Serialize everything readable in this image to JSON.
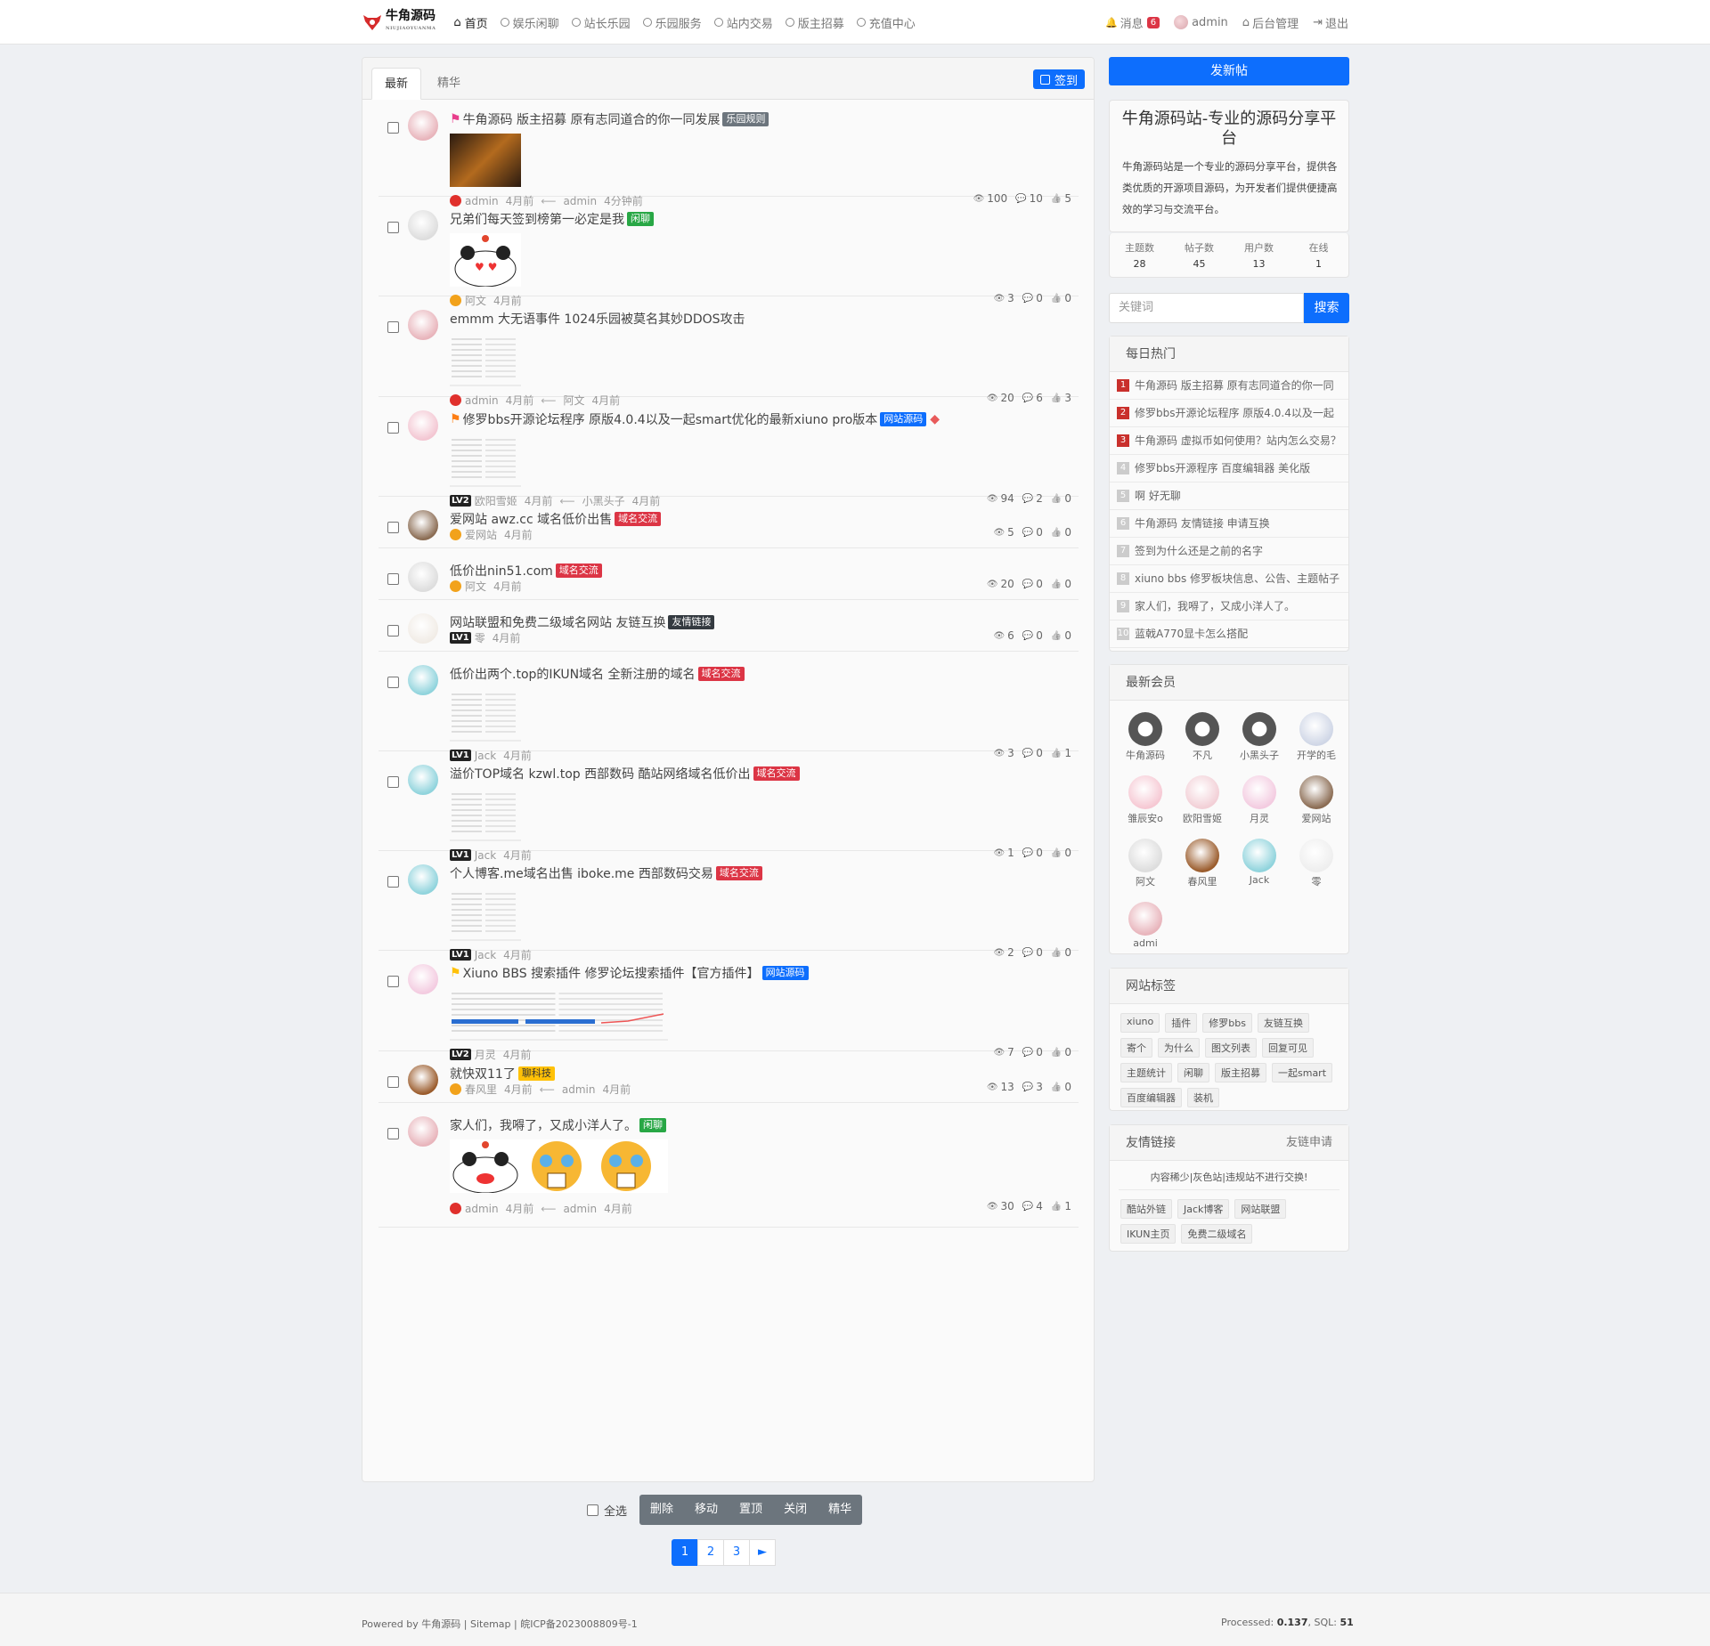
{
  "nav": {
    "logo_text": "牛角源码",
    "logo_sub": "NIUJIAOYUANMA",
    "items": [
      {
        "label": "首页",
        "icon": "home-icon",
        "active": true
      },
      {
        "label": "娱乐闲聊",
        "icon": "circle-icon"
      },
      {
        "label": "站长乐园",
        "icon": "circle-icon"
      },
      {
        "label": "乐园服务",
        "icon": "circle-icon"
      },
      {
        "label": "站内交易",
        "icon": "circle-icon"
      },
      {
        "label": "版主招募",
        "icon": "circle-icon"
      },
      {
        "label": "充值中心",
        "icon": "circle-icon"
      }
    ],
    "messages_label": "消息",
    "messages_count": "6",
    "user_label": "admin",
    "admin_label": "后台管理",
    "logout_label": "退出"
  },
  "tabs": {
    "latest": "最新",
    "featured": "精华"
  },
  "signin_label": "签到",
  "threads": [
    {
      "title": "牛角源码 版主招募 原有志同道合的你一同发展",
      "flag": "#e83e8c",
      "tag": "乐园规则",
      "tag_color": "#6c757d",
      "user": "admin",
      "time": "4月前",
      "last_user": "admin",
      "last_time": "4分钟前",
      "views": "100",
      "replies": "10",
      "likes": "5",
      "badge": "vip-red"
    },
    {
      "title": "兄弟们每天签到榜第一必定是我",
      "tag": "闲聊",
      "tag_color": "#28a745",
      "user": "阿文",
      "time": "4月前",
      "views": "3",
      "replies": "0",
      "likes": "0",
      "badge": "vip-gold"
    },
    {
      "title": "emmm 大无语事件 1024乐园被莫名其妙DDOS攻击",
      "user": "admin",
      "time": "4月前",
      "last_user": "阿文",
      "last_time": "4月前",
      "views": "20",
      "replies": "6",
      "likes": "3",
      "badge": "vip-red"
    },
    {
      "title": "修罗bbs开源论坛程序 原版4.0.4以及一起smart优化的最新xiuno pro版本",
      "flag": "#fd7e14",
      "tag": "网站源码",
      "tag_color": "#0d6efd",
      "user": "欧阳雪姬",
      "time": "4月前",
      "last_user": "小黑头子",
      "last_time": "4月前",
      "views": "94",
      "replies": "2",
      "likes": "0",
      "level": "LV2"
    },
    {
      "title": "爱网站 awz.cc 域名低价出售",
      "tag": "域名交流",
      "tag_color": "#dc3545",
      "user": "爱网站",
      "time": "4月前",
      "views": "5",
      "replies": "0",
      "likes": "0",
      "badge": "vip-gold"
    },
    {
      "title": "低价出nin51.com",
      "tag": "域名交流",
      "tag_color": "#dc3545",
      "user": "阿文",
      "time": "4月前",
      "views": "20",
      "replies": "0",
      "likes": "0",
      "badge": "vip-gold"
    },
    {
      "title": "网站联盟和免费二级域名网站 友链互换",
      "tag": "友情链接",
      "tag_color": "#343a40",
      "user": "零",
      "time": "4月前",
      "views": "6",
      "replies": "0",
      "likes": "0",
      "level": "LV1"
    },
    {
      "title": "低价出两个.top的IKUN域名 全新注册的域名",
      "tag": "域名交流",
      "tag_color": "#dc3545",
      "user": "Jack",
      "time": "4月前",
      "views": "3",
      "replies": "0",
      "likes": "1",
      "level": "LV1"
    },
    {
      "title": "溢价TOP域名 kzwl.top 西部数码 酷站网络域名低价出",
      "tag": "域名交流",
      "tag_color": "#dc3545",
      "user": "Jack",
      "time": "4月前",
      "views": "1",
      "replies": "0",
      "likes": "0",
      "level": "LV1"
    },
    {
      "title": "个人博客.me域名出售 iboke.me 西部数码交易",
      "tag": "域名交流",
      "tag_color": "#dc3545",
      "user": "Jack",
      "time": "4月前",
      "views": "2",
      "replies": "0",
      "likes": "0",
      "level": "LV1"
    },
    {
      "title": "Xiuno BBS 搜索插件 修罗论坛搜索插件【官方插件】",
      "flag": "#ffc107",
      "tag": "网站源码",
      "tag_color": "#0d6efd",
      "user": "月灵",
      "time": "4月前",
      "views": "7",
      "replies": "0",
      "likes": "0",
      "level": "LV2"
    },
    {
      "title": "就快双11了",
      "tag": "聊科技",
      "tag_color": "#ffc107",
      "user": "春风里",
      "time": "4月前",
      "last_user": "admin",
      "last_time": "4月前",
      "views": "13",
      "replies": "3",
      "likes": "0",
      "badge": "vip-gold"
    },
    {
      "title": "家人们，我嘚了，又成小洋人了。",
      "tag": "闲聊",
      "tag_color": "#28a745",
      "user": "admin",
      "time": "4月前",
      "last_user": "admin",
      "last_time": "4月前",
      "views": "30",
      "replies": "4",
      "likes": "1",
      "badge": "vip-red"
    }
  ],
  "bulk": {
    "select_all": "全选",
    "delete": "删除",
    "move": "移动",
    "top": "置顶",
    "close": "关闭",
    "digest": "精华"
  },
  "pager": [
    "1",
    "2",
    "3",
    "►"
  ],
  "footer": {
    "powered": "Powered by",
    "site": "牛角源码",
    "sitemap": "Sitemap",
    "icp": "皖ICP备2023008809号-1",
    "processed_label": "Processed:",
    "processed": "0.137",
    "sql_label": "SQL:",
    "sql": "51"
  },
  "sidebar": {
    "post_btn": "发新帖",
    "site_title": "牛角源码站-专业的源码分享平台",
    "site_desc": "牛角源码站是一个专业的源码分享平台，提供各类优质的开源项目源码，为开发者们提供便捷高效的学习与交流平台。",
    "stats": [
      {
        "label": "主题数",
        "value": "28"
      },
      {
        "label": "帖子数",
        "value": "45"
      },
      {
        "label": "用户数",
        "value": "13"
      },
      {
        "label": "在线",
        "value": "1"
      }
    ],
    "search_placeholder": "关键词",
    "search_btn": "搜索",
    "hot_title": "每日热门",
    "hot": [
      "牛角源码 版主招募 原有志同道合的你一同",
      "修罗bbs开源论坛程序 原版4.0.4以及一起",
      "牛角源码 虚拟币如何使用？站内怎么交易？",
      "修罗bbs开源程序 百度编辑器 美化版",
      "啊 好无聊",
      "牛角源码 友情链接 申请互换",
      "签到为什么还是之前的名字",
      "xiuno bbs 修罗板块信息、公告、主题帖子",
      "家人们，我嘚了，又成小洋人了。",
      "蓝戟A770显卡怎么搭配"
    ],
    "members_title": "最新会员",
    "members": [
      "牛角源码",
      "不凡",
      "小黑头子",
      "开学的毛",
      "雏辰安o",
      "欧阳雪姬",
      "月灵",
      "爱网站",
      "阿文",
      "春风里",
      "Jack",
      "零",
      "admi"
    ],
    "tags_title": "网站标签",
    "tags": [
      "xiuno",
      "插件",
      "修罗bbs",
      "友链互换",
      "寄个",
      "为什么",
      "图文列表",
      "回复可见",
      "主题统计",
      "闲聊",
      "版主招募",
      "一起smart",
      "百度编辑器",
      "装机"
    ],
    "links_title": "友情链接",
    "links_apply": "友链申请",
    "links_note": "内容稀少|灰色站|违规站不进行交换!",
    "links": [
      "酷站外链",
      "Jack博客",
      "网站联盟",
      "IKUN主页",
      "免费二级域名"
    ]
  }
}
